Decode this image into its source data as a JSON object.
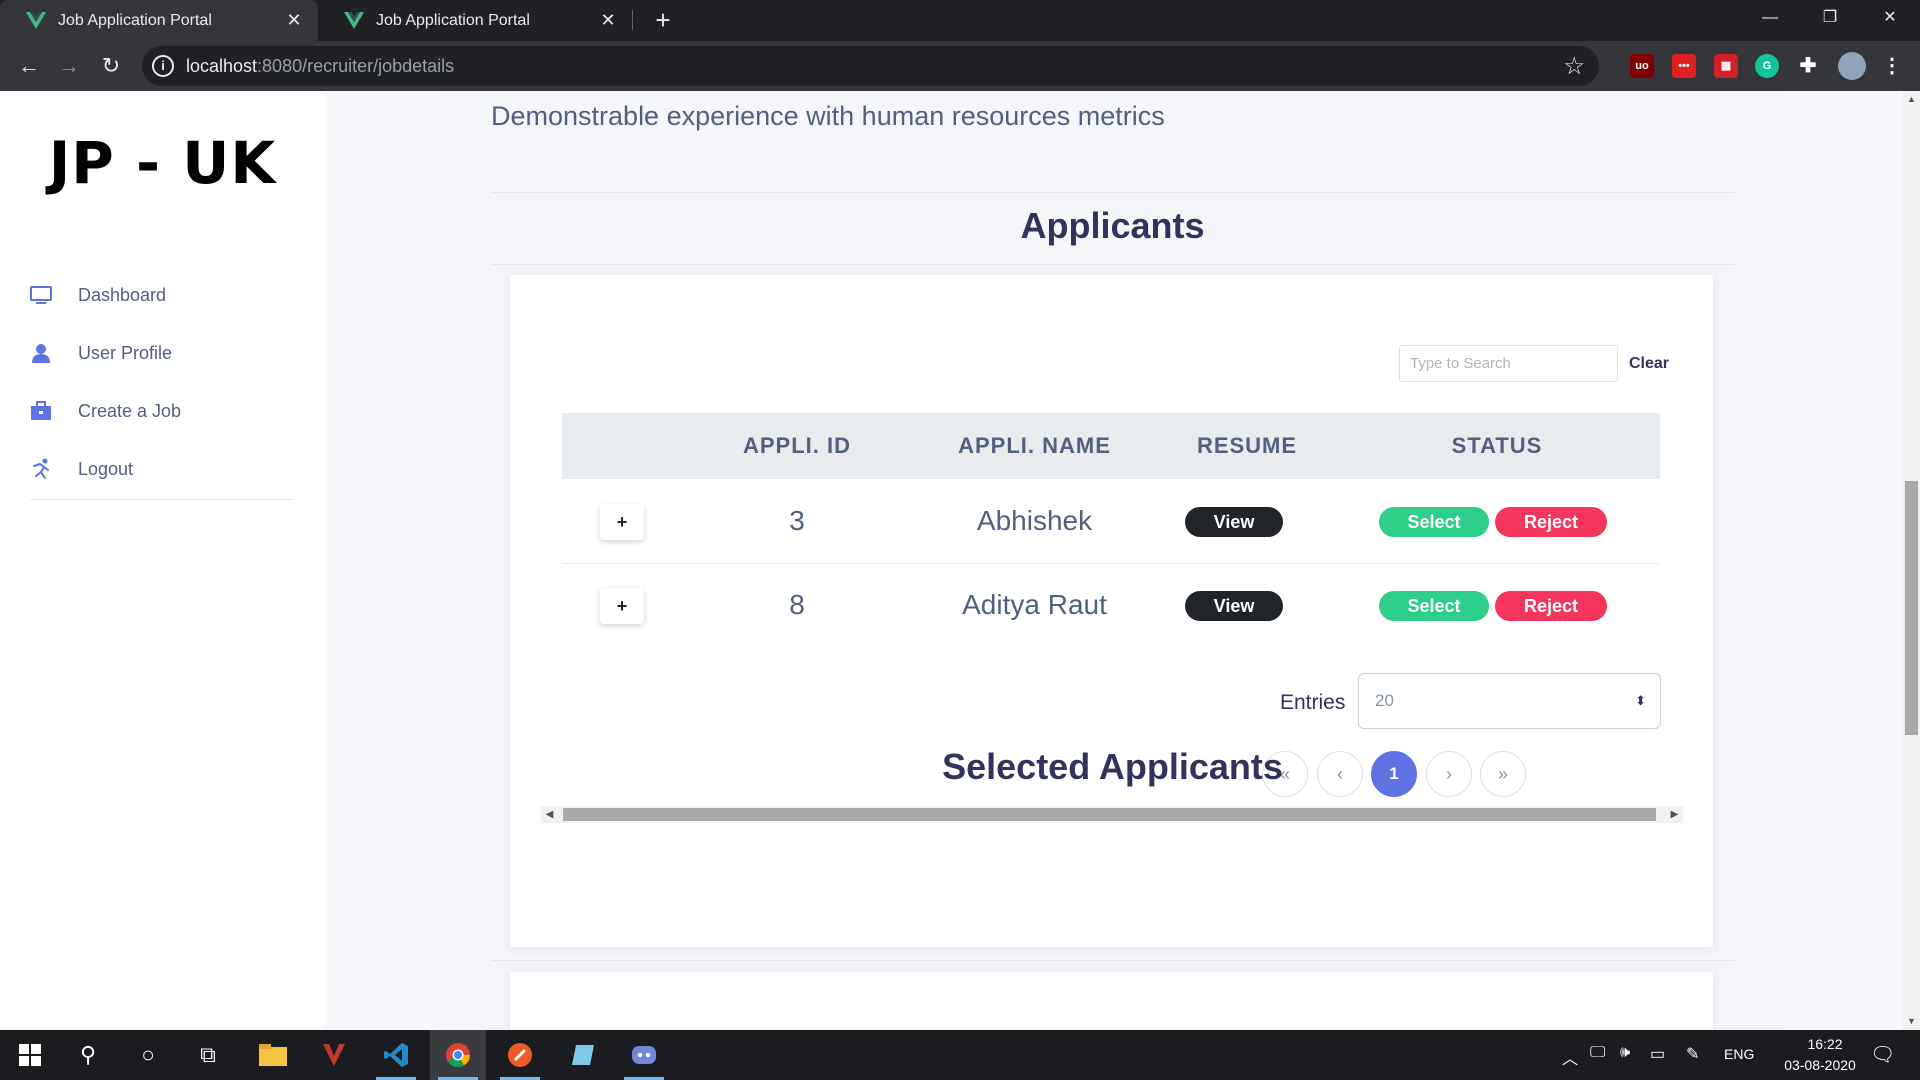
{
  "browser": {
    "tabs": [
      {
        "title": "Job Application Portal",
        "active": true
      },
      {
        "title": "Job Application Portal",
        "active": false
      }
    ],
    "url_host": "localhost",
    "url_path": ":8080/recruiter/jobdetails"
  },
  "sidebar": {
    "brand": "JP - UK",
    "items": [
      {
        "label": "Dashboard",
        "icon": "monitor-icon"
      },
      {
        "label": "User Profile",
        "icon": "user-icon"
      },
      {
        "label": "Create a Job",
        "icon": "briefcase-icon"
      },
      {
        "label": "Logout",
        "icon": "running-person-icon"
      }
    ]
  },
  "main": {
    "job_description": "Demonstrable experience with human resources metrics",
    "applicants_title": "Applicants",
    "selected_title": "Selected Applicants",
    "search": {
      "placeholder": "Type to Search",
      "clear_label": "Clear"
    },
    "table": {
      "headers": [
        "APPLI. ID",
        "APPLI. NAME",
        "RESUME",
        "STATUS"
      ],
      "rows": [
        {
          "expand": "+",
          "id": "3",
          "name": "Abhishek",
          "resume": "View",
          "select": "Select",
          "reject": "Reject"
        },
        {
          "expand": "+",
          "id": "8",
          "name": "Aditya Raut",
          "resume": "View",
          "select": "Select",
          "reject": "Reject"
        }
      ]
    },
    "entries": {
      "label": "Entries",
      "value": "20"
    },
    "pagination": {
      "first": "«",
      "prev": "‹",
      "current": "1",
      "next": "›",
      "last": "»"
    }
  },
  "taskbar": {
    "language": "ENG",
    "time": "16:22",
    "date": "03-08-2020"
  },
  "colors": {
    "primary": "#5e72e4",
    "success": "#2dce89",
    "danger": "#f5365c",
    "dark": "#212529",
    "heading": "#32325d"
  }
}
